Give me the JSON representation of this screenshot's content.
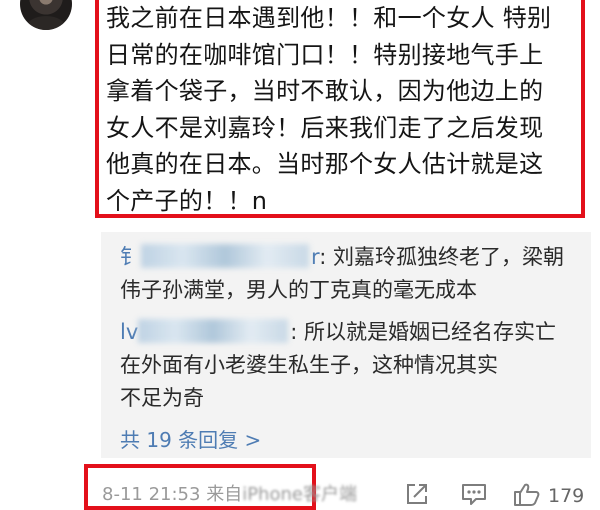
{
  "comment": {
    "text": "我之前在日本遇到他！！和一个女人 特别\n日常的在咖啡馆门口！！特别接地气手上\n拿着个袋子，当时不敢认，因为他边上的\n女人不是刘嘉玲！后来我们走了之后发现\n他真的在日本。当时那个女人估计就是这\n个产子的！！n"
  },
  "replies": [
    {
      "username_visible": "钅",
      "username_tail": "r",
      "text": ": 刘嘉玲孤独终老了，梁朝\n伟子孙满堂，男人的丁克真的毫无成本"
    },
    {
      "username_visible": "lv",
      "username_tail": "",
      "text": ": 所以就是婚姻已经名存实亡\n在外面有小老婆生私生子，这种情况其实\n不足为奇"
    }
  ],
  "more_replies_label": "共 19 条回复 >",
  "meta": {
    "date": "8-11 21:53",
    "source_prefix": "来自",
    "source_name": "iPhone客户端"
  },
  "actions": {
    "like_count": "179"
  },
  "colors": {
    "highlight_border": "#e3101a",
    "link_blue": "#4e7cb3",
    "reply_bg": "#f3f3f3"
  },
  "icons": [
    "share-icon",
    "comment-icon",
    "like-icon"
  ]
}
